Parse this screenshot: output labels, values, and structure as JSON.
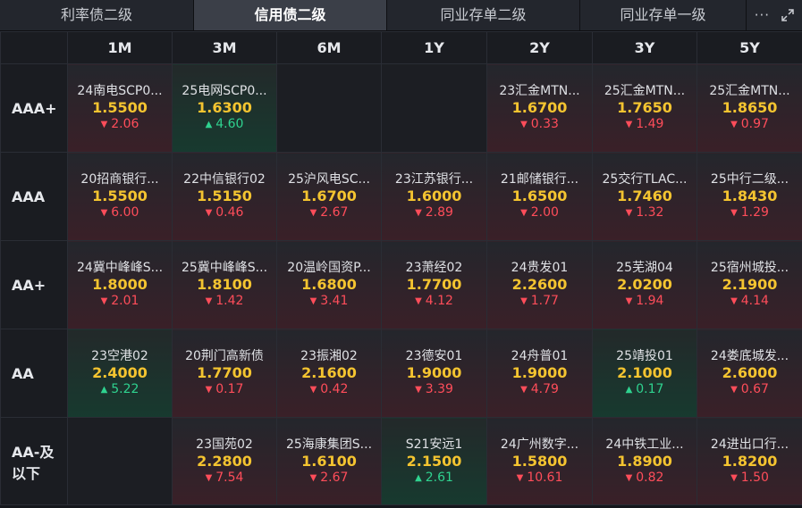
{
  "tabs": [
    {
      "label": "利率债二级",
      "active": false
    },
    {
      "label": "信用债二级",
      "active": true
    },
    {
      "label": "同业存单二级",
      "active": false
    },
    {
      "label": "同业存单一级",
      "active": false
    }
  ],
  "toolbar": {
    "more_label": "···",
    "more_icon": "more-icon",
    "expand_icon": "expand-icon"
  },
  "columns": [
    "1M",
    "3M",
    "6M",
    "1Y",
    "2Y",
    "3Y",
    "5Y"
  ],
  "colors": {
    "down": "#ff4d5a",
    "up": "#2fd28f",
    "yield": "#f4c430"
  },
  "rows": [
    {
      "label": "AAA+",
      "cells": [
        {
          "name": "24南电SCP0...",
          "yield": "1.5500",
          "change": "2.06",
          "dir": "down"
        },
        {
          "name": "25电网SCP0...",
          "yield": "1.6300",
          "change": "4.60",
          "dir": "up"
        },
        null,
        null,
        {
          "name": "23汇金MTN...",
          "yield": "1.6700",
          "change": "0.33",
          "dir": "down"
        },
        {
          "name": "25汇金MTN...",
          "yield": "1.7650",
          "change": "1.49",
          "dir": "down"
        },
        {
          "name": "25汇金MTN...",
          "yield": "1.8650",
          "change": "0.97",
          "dir": "down"
        }
      ]
    },
    {
      "label": "AAA",
      "cells": [
        {
          "name": "20招商银行...",
          "yield": "1.5500",
          "change": "6.00",
          "dir": "down"
        },
        {
          "name": "22中信银行02",
          "yield": "1.5150",
          "change": "0.46",
          "dir": "down"
        },
        {
          "name": "25沪风电SC...",
          "yield": "1.6700",
          "change": "2.67",
          "dir": "down"
        },
        {
          "name": "23江苏银行...",
          "yield": "1.6000",
          "change": "2.89",
          "dir": "down"
        },
        {
          "name": "21邮储银行...",
          "yield": "1.6500",
          "change": "2.00",
          "dir": "down"
        },
        {
          "name": "25交行TLAC...",
          "yield": "1.7460",
          "change": "1.32",
          "dir": "down"
        },
        {
          "name": "25中行二级...",
          "yield": "1.8430",
          "change": "1.29",
          "dir": "down"
        }
      ]
    },
    {
      "label": "AA+",
      "cells": [
        {
          "name": "24冀中峰峰S...",
          "yield": "1.8000",
          "change": "2.01",
          "dir": "down"
        },
        {
          "name": "25冀中峰峰S...",
          "yield": "1.8100",
          "change": "1.42",
          "dir": "down"
        },
        {
          "name": "20温岭国资P...",
          "yield": "1.6800",
          "change": "3.41",
          "dir": "down"
        },
        {
          "name": "23萧经02",
          "yield": "1.7700",
          "change": "4.12",
          "dir": "down"
        },
        {
          "name": "24贵发01",
          "yield": "2.2600",
          "change": "1.77",
          "dir": "down"
        },
        {
          "name": "25芜湖04",
          "yield": "2.0200",
          "change": "1.94",
          "dir": "down"
        },
        {
          "name": "25宿州城投...",
          "yield": "2.1900",
          "change": "4.14",
          "dir": "down"
        }
      ]
    },
    {
      "label": "AA",
      "cells": [
        {
          "name": "23空港02",
          "yield": "2.4000",
          "change": "5.22",
          "dir": "up"
        },
        {
          "name": "20荆门高新债",
          "yield": "1.7700",
          "change": "0.17",
          "dir": "down"
        },
        {
          "name": "23振湘02",
          "yield": "2.1600",
          "change": "0.42",
          "dir": "down"
        },
        {
          "name": "23德安01",
          "yield": "1.9000",
          "change": "3.39",
          "dir": "down"
        },
        {
          "name": "24舟普01",
          "yield": "1.9000",
          "change": "4.79",
          "dir": "down"
        },
        {
          "name": "25靖投01",
          "yield": "2.1000",
          "change": "0.17",
          "dir": "up"
        },
        {
          "name": "24娄底城发...",
          "yield": "2.6000",
          "change": "0.67",
          "dir": "down"
        }
      ]
    },
    {
      "label": "AA-及\n以下",
      "cells": [
        null,
        {
          "name": "23国苑02",
          "yield": "2.2800",
          "change": "7.54",
          "dir": "down"
        },
        {
          "name": "25海康集团S...",
          "yield": "1.6100",
          "change": "2.67",
          "dir": "down"
        },
        {
          "name": "S21安远1",
          "yield": "2.1500",
          "change": "2.61",
          "dir": "up"
        },
        {
          "name": "24广州数字...",
          "yield": "1.5800",
          "change": "10.61",
          "dir": "down"
        },
        {
          "name": "24中铁工业...",
          "yield": "1.8900",
          "change": "0.82",
          "dir": "down"
        },
        {
          "name": "24进出口行...",
          "yield": "1.8200",
          "change": "1.50",
          "dir": "down"
        }
      ]
    }
  ]
}
